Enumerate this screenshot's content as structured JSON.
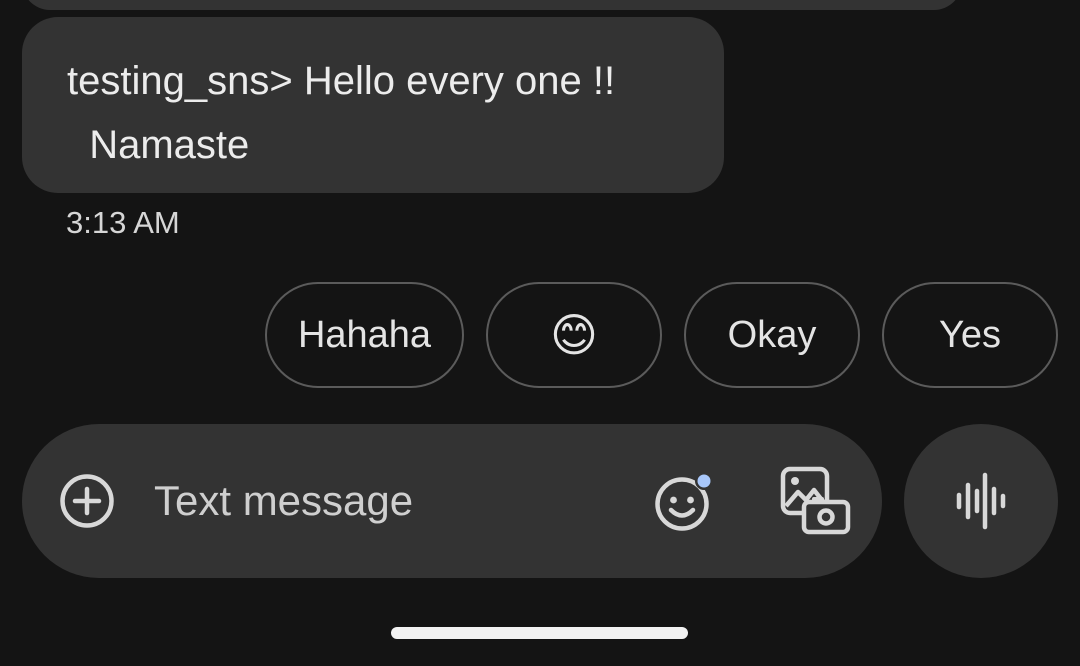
{
  "message": {
    "text": "testing_sns> Hello every one !!\n  Namaste",
    "timestamp": "3:13 AM"
  },
  "smart_replies": [
    {
      "label": "Hahaha"
    },
    {
      "label": "😊"
    },
    {
      "label": "Okay"
    },
    {
      "label": "Yes"
    }
  ],
  "compose": {
    "placeholder": "Text message",
    "attach_icon": "add-circle-icon",
    "emoji_icon": "emoji-icon",
    "gallery_icon": "gallery-icon",
    "voice_icon": "voice-waveform-icon"
  },
  "colors": {
    "background": "#141414",
    "bubble": "#333333",
    "chip_border": "#5b5b5b",
    "emoji_badge": "#a8c7fa"
  }
}
